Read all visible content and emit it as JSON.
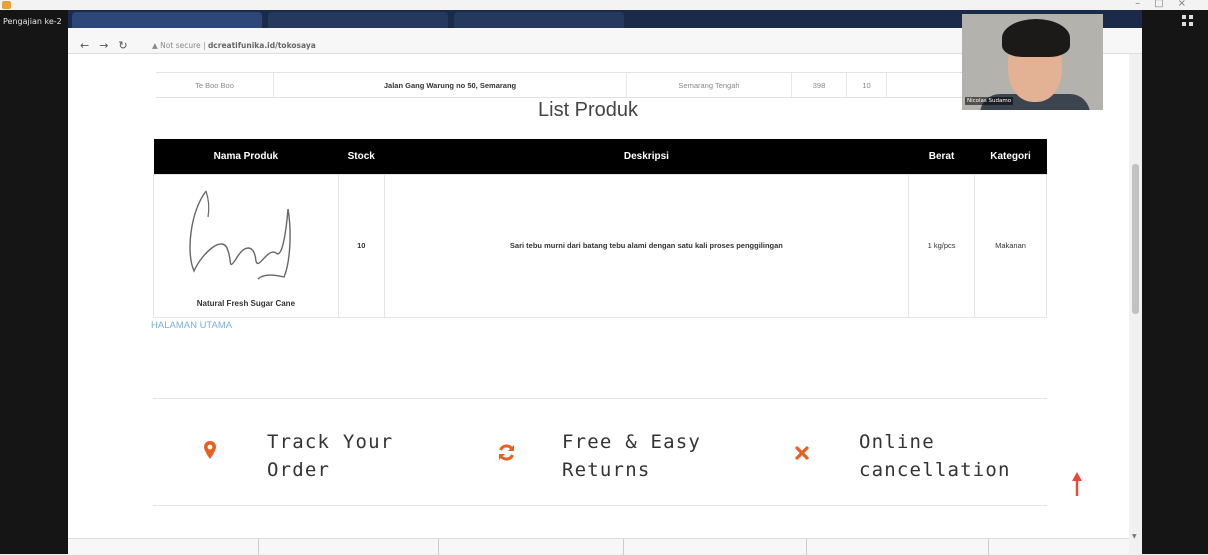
{
  "meeting": {
    "title": "Pengajian ke-2",
    "participant_name": "Nicolas Sudamo"
  },
  "browser": {
    "security_label": "Not secure",
    "url": "dcreatifunika.id/tokosaya"
  },
  "address_row": [
    "Te Boo Boo",
    "Jalan Gang Warung no 50, Semarang",
    "Semarang Tengah",
    "398",
    "10"
  ],
  "section_title": "List Produk",
  "table": {
    "headers": [
      "Nama Produk",
      "Stock",
      "Deskripsi",
      "Berat",
      "Kategori"
    ],
    "rows": [
      {
        "name": "Natural Fresh Sugar Cane",
        "stock": "10",
        "description": "Sari tebu murni dari batang tebu alami dengan satu kali proses penggilingan",
        "weight": "1 kg/pcs",
        "category": "Makanan"
      }
    ]
  },
  "home_link": "HALAMAN UTAMA",
  "features": [
    {
      "icon": "map-pin-icon",
      "line1": "Track Your",
      "line2": "Order"
    },
    {
      "icon": "refresh-icon",
      "line1": "Free & Easy",
      "line2": "Returns"
    },
    {
      "icon": "close-x-icon",
      "line1": "Online",
      "line2": "cancellation"
    }
  ],
  "colors": {
    "accent": "#e8601f",
    "link": "#7ab0d9",
    "table_header": "#000000"
  }
}
